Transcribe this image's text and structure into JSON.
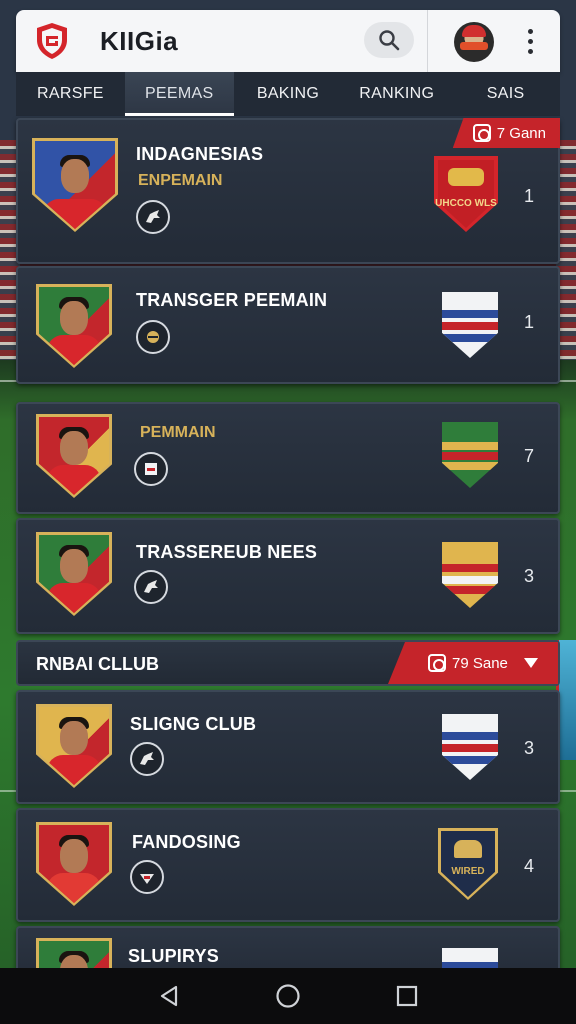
{
  "header": {
    "title": "KIIGia",
    "logo_icon": "shield-logo-icon",
    "search_icon": "search-icon",
    "menu_icon": "kebab-menu-icon"
  },
  "tabs": [
    {
      "label": "RARSFE"
    },
    {
      "label": "PEEMAS",
      "active": true
    },
    {
      "label": "BAKING"
    },
    {
      "label": "RANKING"
    },
    {
      "label": "SAIS"
    }
  ],
  "list_top": {
    "badge_text": "7 Gann",
    "items": [
      {
        "name": "INDAGNESIAS",
        "subtitle": "ENPEMAIN",
        "rank": "1",
        "crest_label": "UHCCO\nWLS"
      },
      {
        "name": "TRANSGER PEEMAIN",
        "subtitle": "",
        "rank": "1",
        "crest_label": ""
      },
      {
        "name": "",
        "subtitle": "PEMMAIN",
        "rank": "7",
        "crest_label": ""
      },
      {
        "name": "TRASSEREUB NEES",
        "subtitle": "",
        "rank": "3",
        "crest_label": ""
      }
    ]
  },
  "section": {
    "title": "RNBAI CLLUB",
    "filter_label": "79 Sane"
  },
  "list_bottom": {
    "items": [
      {
        "name": "SLIGNG CLUB",
        "rank": "3"
      },
      {
        "name": "FANDOSING",
        "rank": "4",
        "crest_label": "WIRED"
      },
      {
        "name": "SLUPIRYS",
        "rank": ""
      }
    ]
  },
  "colors": {
    "accent_red": "#c5242a",
    "gold": "#d7b25a",
    "card_bg": "#2c3543",
    "header_bg": "#f5f6f8"
  }
}
